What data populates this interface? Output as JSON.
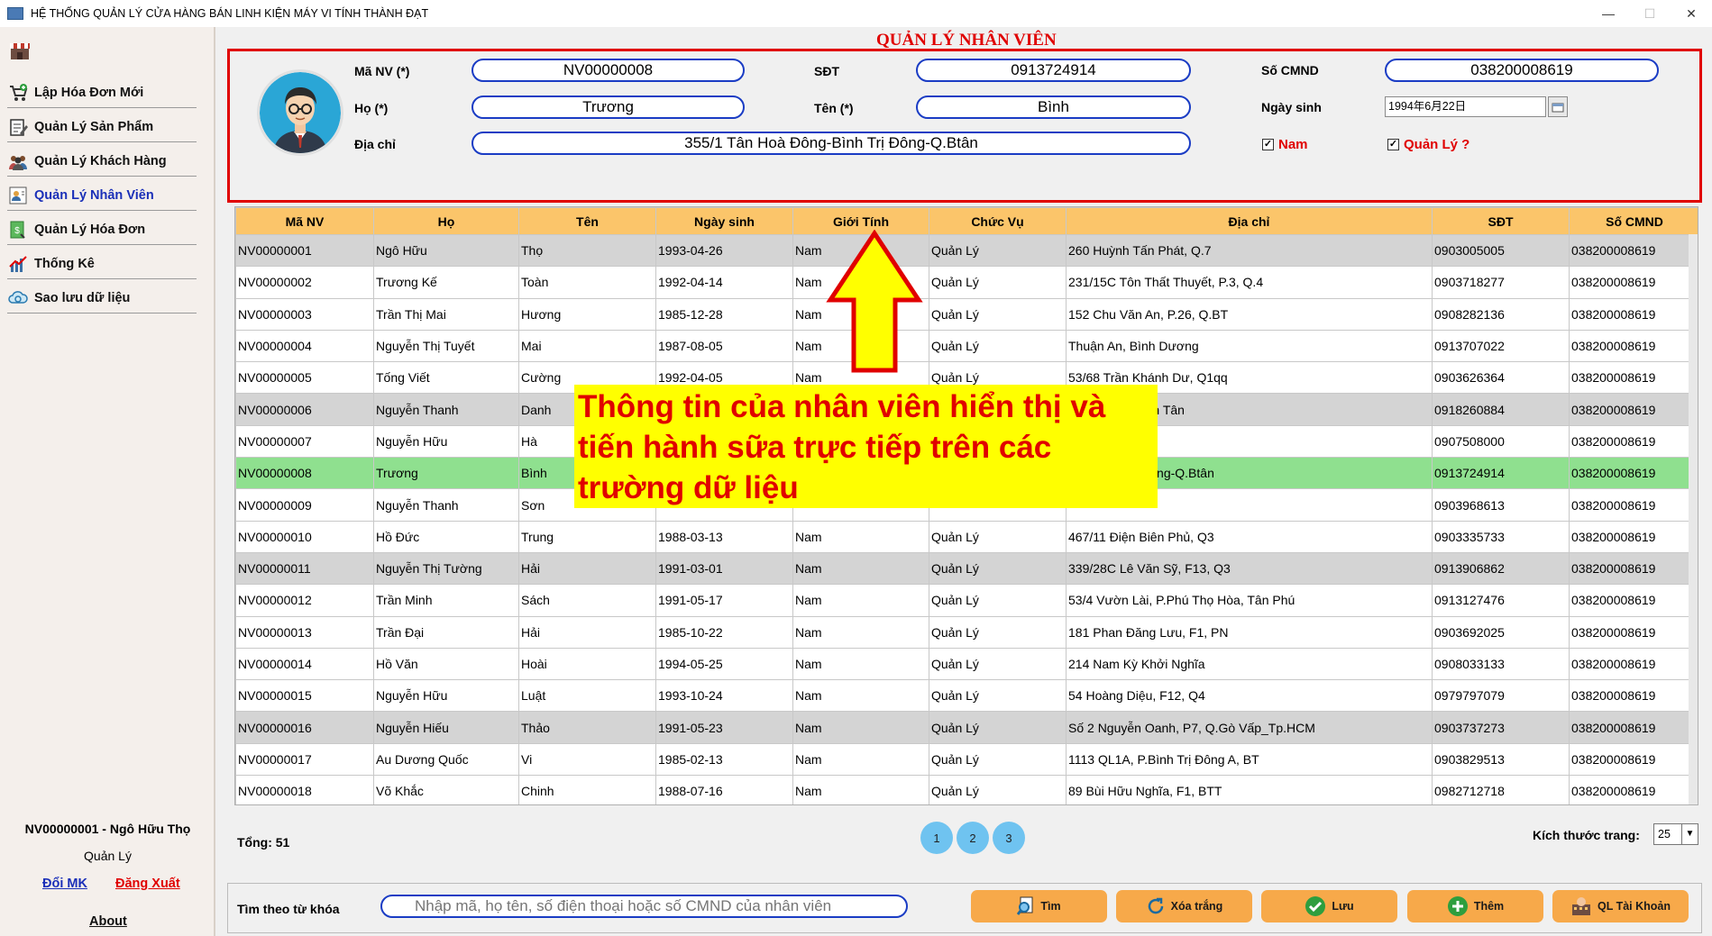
{
  "window": {
    "title": "HỆ THỐNG QUẢN LÝ CỬA HÀNG BÁN LINH KIỆN MÁY VI TÍNH THÀNH ĐẠT",
    "minimize": "—",
    "maximize": "☐",
    "close": "✕"
  },
  "sidebar": {
    "items": [
      {
        "label": "Lập Hóa Đơn Mới",
        "icon": "cart-add-icon"
      },
      {
        "label": "Quản Lý Sản Phẩm",
        "icon": "edit-doc-icon"
      },
      {
        "label": "Quản Lý Khách Hàng",
        "icon": "users-icon"
      },
      {
        "label": "Quản Lý Nhân Viên",
        "icon": "employee-icon"
      },
      {
        "label": "Quản Lý Hóa Đơn",
        "icon": "invoice-icon"
      },
      {
        "label": "Thống Kê",
        "icon": "chart-icon"
      },
      {
        "label": "Sao lưu dữ liệu",
        "icon": "backup-icon"
      }
    ],
    "user_line": "NV00000001 - Ngô Hữu  Thọ",
    "role": "Quản Lý",
    "change_password": "Đổi MK",
    "logout": "Đăng Xuất",
    "about": "About"
  },
  "form": {
    "title": "QUẢN LÝ NHÂN VIÊN",
    "labels": {
      "ma_nv": "Mã NV (*)",
      "ho": "Họ (*)",
      "dia_chi": "Địa chỉ",
      "sdt": "SĐT",
      "ten": "Tên (*)",
      "so_cmnd": "Số CMND",
      "ngay_sinh": "Ngày sinh"
    },
    "values": {
      "ma_nv": "NV00000008",
      "ho": "Trương",
      "dia_chi": "355/1 Tân Hoà Đông-Bình Trị Đông-Q.Btân",
      "sdt": "0913724914",
      "ten": "Bình",
      "so_cmnd": "038200008619",
      "ngay_sinh": "1994年6月22日"
    },
    "nam_label": "Nam",
    "quanly_label": "Quản Lý ?",
    "nam_checked": "✓",
    "quanly_checked": "✓"
  },
  "table": {
    "headers": [
      "Mã NV",
      "Họ",
      "Tên",
      "Ngày sinh",
      "Giới Tính",
      "Chức Vụ",
      "Địa chỉ",
      "SĐT",
      "Số CMND"
    ],
    "rows": [
      [
        "NV00000001",
        "Ngô Hữu",
        "Thọ",
        "1993-04-26",
        "Nam",
        "Quản Lý",
        "260 Huỳnh Tấn Phát, Q.7",
        "0903005005",
        "038200008619"
      ],
      [
        "NV00000002",
        "Trương Kế",
        "Toàn",
        "1992-04-14",
        "Nam",
        "Quản Lý",
        "231/15C Tôn Thất Thuyết, P.3, Q.4",
        "0903718277",
        "038200008619"
      ],
      [
        "NV00000003",
        "Trần Thị Mai",
        "Hương",
        "1985-12-28",
        "Nam",
        "Quản Lý",
        "152 Chu Văn An, P.26, Q.BT",
        "0908282136",
        "038200008619"
      ],
      [
        "NV00000004",
        "Nguyễn Thị Tuyết",
        "Mai",
        "1987-08-05",
        "Nam",
        "Quản Lý",
        "Thuận An, Bình Dương",
        "0913707022",
        "038200008619"
      ],
      [
        "NV00000005",
        "Tống Viết",
        "Cường",
        "1992-04-05",
        "Nam",
        "Quản Lý",
        "53/68 Trần Khánh Dư, Q1qq",
        "0903626364",
        "038200008619"
      ],
      [
        "NV00000006",
        "Nguyễn Thanh",
        "Danh",
        "",
        "",
        "",
        "P Tân Tạo, Bình Tân",
        "0918260884",
        "038200008619"
      ],
      [
        "NV00000007",
        "Nguyễn Hữu",
        "Hà",
        "",
        "",
        "",
        ", F11, Q10",
        "0907508000",
        "038200008619"
      ],
      [
        "NV00000008",
        "Trương",
        "Bình",
        "",
        "",
        "",
        "ông-Bình Trị Đông-Q.Btân",
        "0913724914",
        "038200008619"
      ],
      [
        "NV00000009",
        "Nguyễn Thanh",
        "Sơn",
        "",
        "",
        "",
        "",
        "0903968613",
        "038200008619"
      ],
      [
        "NV00000010",
        "Hồ Đức",
        "Trung",
        "1988-03-13",
        "Nam",
        "Quản Lý",
        "467/11 Điện Biên Phủ, Q3",
        "0903335733",
        "038200008619"
      ],
      [
        "NV00000011",
        "Nguyễn Thị Tường",
        "Hải",
        "1991-03-01",
        "Nam",
        "Quản Lý",
        "339/28C Lê Văn Sỹ, F13, Q3",
        "0913906862",
        "038200008619"
      ],
      [
        "NV00000012",
        "Trần Minh",
        "Sách",
        "1991-05-17",
        "Nam",
        "Quản Lý",
        "53/4 Vườn Lài, P.Phú Thọ Hòa, Tân Phú",
        "0913127476",
        "038200008619"
      ],
      [
        "NV00000013",
        "Trần Đại",
        "Hải",
        "1985-10-22",
        "Nam",
        "Quản Lý",
        "181 Phan Đăng Lưu, F1, PN",
        "0903692025",
        "038200008619"
      ],
      [
        "NV00000014",
        "Hồ Văn",
        "Hoài",
        "1994-05-25",
        "Nam",
        "Quản Lý",
        "214 Nam Kỳ Khởi Nghĩa",
        "0908033133",
        "038200008619"
      ],
      [
        "NV00000015",
        "Nguyễn Hữu",
        "Luật",
        "1993-10-24",
        "Nam",
        "Quản Lý",
        "54 Hoàng Diệu, F12, Q4",
        "0979797079",
        "038200008619"
      ],
      [
        "NV00000016",
        "Nguyễn Hiếu",
        "Thảo",
        "1991-05-23",
        "Nam",
        "Quản Lý",
        "Số 2 Nguyễn Oanh, P7, Q.Gò Vấp_Tp.HCM",
        "0903737273",
        "038200008619"
      ],
      [
        "NV00000017",
        "Au Dương Quốc",
        "Vi",
        "1985-02-13",
        "Nam",
        "Quản Lý",
        "1113 QL1A, P.Bình Trị Đông A, BT",
        "0903829513",
        "038200008619"
      ],
      [
        "NV00000018",
        "Võ Khắc",
        "Chinh",
        "1988-07-16",
        "Nam",
        "Quản Lý",
        "89 Bùi Hữu Nghĩa, F1, BTT",
        "0982712718",
        "038200008619"
      ]
    ],
    "row_styles": [
      "gray",
      "",
      "",
      "",
      "",
      "gray",
      "",
      "sel",
      "",
      "",
      "gray",
      "",
      "",
      "",
      "",
      "gray",
      "",
      ""
    ]
  },
  "pagination": {
    "total": "Tổng: 51",
    "pages": [
      "1",
      "2",
      "3"
    ],
    "page_size_label": "Kích thước trang:",
    "page_size": "25",
    "dropdown_arrow": "▼"
  },
  "search": {
    "label": "Tìm theo từ khóa",
    "placeholder": "Nhập mã, họ tên, số điện thoại hoặc số CMND của nhân viên"
  },
  "buttons": [
    {
      "label": "Tìm",
      "icon": "search-doc-icon"
    },
    {
      "label": "Xóa trắng",
      "icon": "refresh-icon"
    },
    {
      "label": "Lưu",
      "icon": "check-icon"
    },
    {
      "label": "Thêm",
      "icon": "plus-icon"
    },
    {
      "label": "QL Tài Khoản",
      "icon": "account-icon"
    }
  ],
  "annotation": {
    "text": "Thông tin của nhân viên hiển thị và tiến hành sữa trực tiếp trên các trường dữ liệu"
  },
  "colors": {
    "accent_red": "#e00000",
    "header_orange": "#fbc56a",
    "selected_green": "#8fe08f",
    "input_border": "#1a3cc4",
    "button_orange": "#f7a94a",
    "annotation_yellow": "#ffff00"
  }
}
